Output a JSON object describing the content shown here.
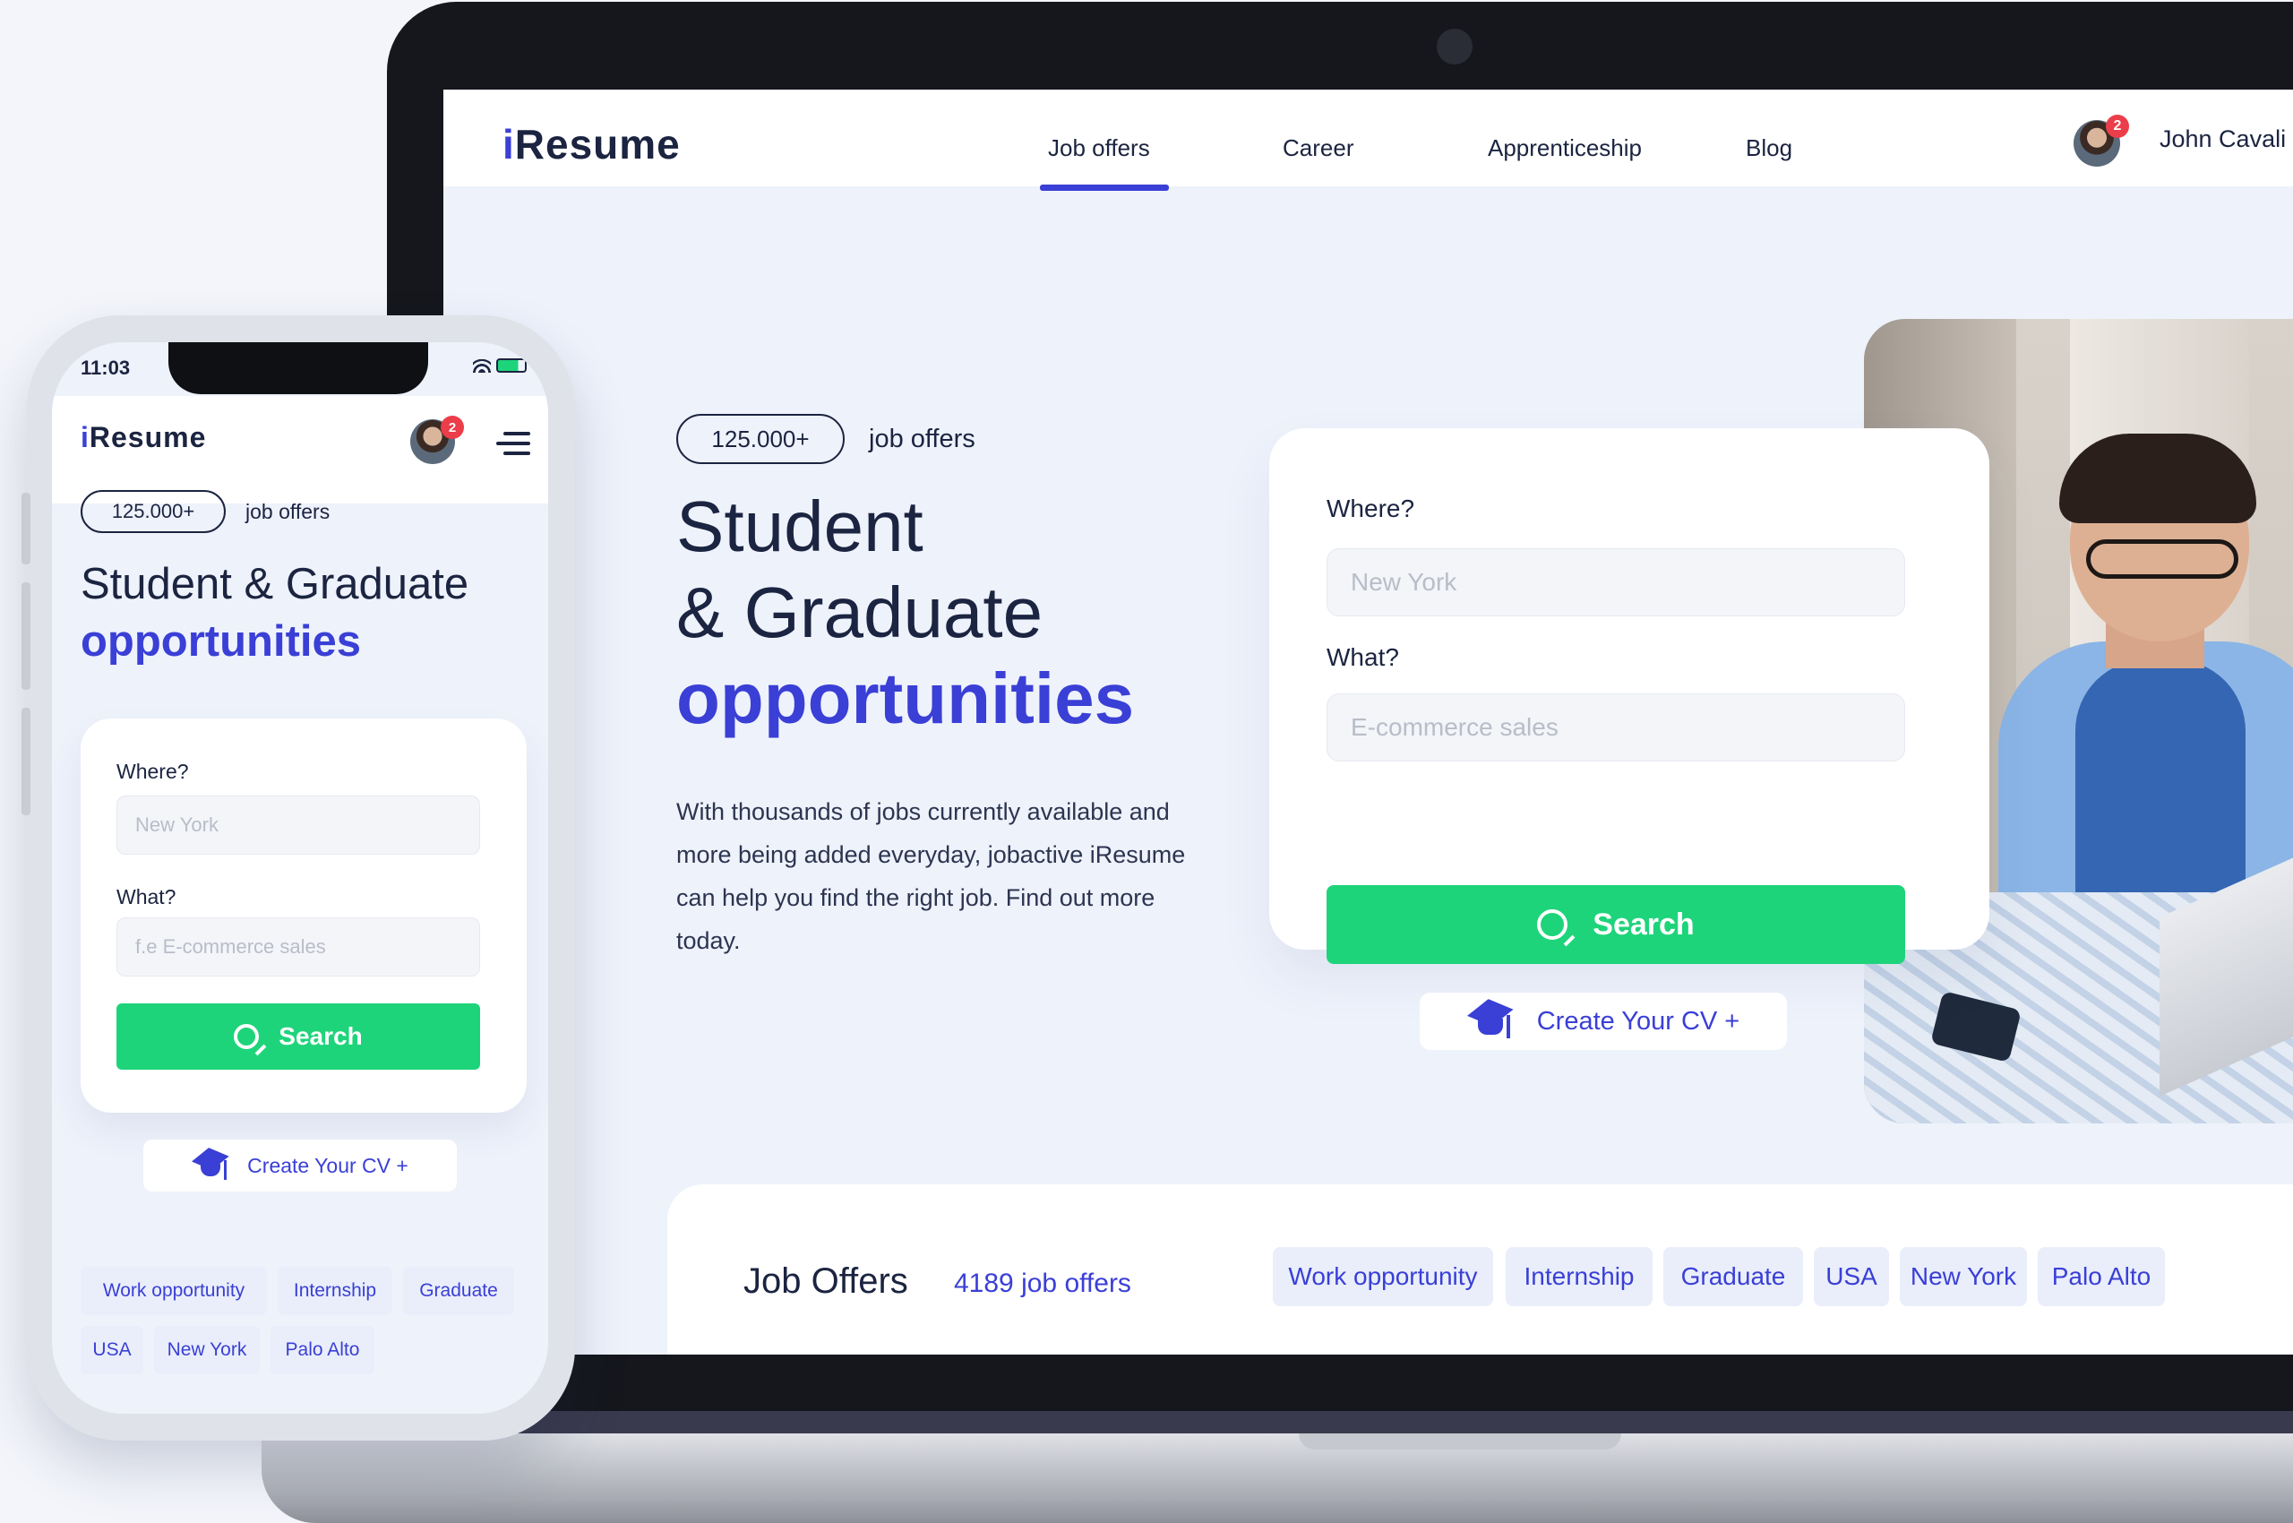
{
  "colors": {
    "accent": "#3a3fd6",
    "search_green": "#1ed47a",
    "badge_red": "#ec3d4a",
    "tag_bg": "#e9eefa",
    "page_bg": "#eef2fb"
  },
  "desktop": {
    "logo": {
      "i": "i",
      "rest": "Resume"
    },
    "nav": {
      "items": [
        {
          "label": "Job offers",
          "active": true
        },
        {
          "label": "Career",
          "active": false
        },
        {
          "label": "Apprenticeship",
          "active": false
        },
        {
          "label": "Blog",
          "active": false
        }
      ]
    },
    "user": {
      "name": "John Cavali",
      "notifications": "2"
    },
    "hero": {
      "count": "125.000+",
      "count_label": "job offers",
      "title_line1": "Student",
      "title_line2": "& Graduate",
      "title_accent": "opportunities",
      "description": "With thousands of jobs currently available and more being added everyday, jobactive iResume can help you find the right job. Find out more today."
    },
    "search": {
      "where_label": "Where?",
      "where_placeholder": "New York",
      "what_label": "What?",
      "what_placeholder": "E-commerce sales",
      "button_label": "Search"
    },
    "create_cv": "Create Your CV +",
    "offers": {
      "title": "Job Offers",
      "count": "4189 job offers",
      "tags": [
        "Work opportunity",
        "Internship",
        "Graduate",
        "USA",
        "New York",
        "Palo Alto"
      ]
    }
  },
  "mobile": {
    "status": {
      "time": "11:03"
    },
    "logo": {
      "i": "i",
      "rest": "Resume"
    },
    "user": {
      "notifications": "2"
    },
    "hero": {
      "count": "125.000+",
      "count_label": "job offers",
      "title_line1": "Student & Graduate",
      "title_accent": "opportunities"
    },
    "search": {
      "where_label": "Where?",
      "where_placeholder": "New York",
      "what_label": "What?",
      "what_placeholder": "f.e E-commerce sales",
      "button_label": "Search"
    },
    "create_cv": "Create Your CV +",
    "tags": [
      "Work opportunity",
      "Internship",
      "Graduate",
      "USA",
      "New York",
      "Palo Alto"
    ]
  }
}
